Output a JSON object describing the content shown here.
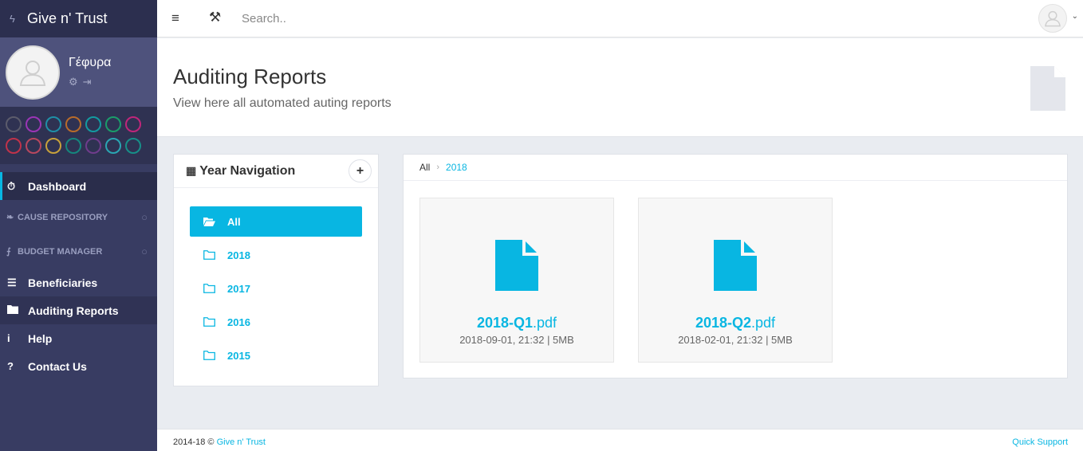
{
  "app": {
    "name": "Give n' Trust"
  },
  "user": {
    "name": "Γέφυρα"
  },
  "theme_colors": {
    "row1": [
      "#5b5b6b",
      "#9b35b5",
      "#1f8fa6",
      "#b86b2a",
      "#139aa0",
      "#1a9c6a",
      "#c0267a"
    ],
    "row2": [
      "#c0324a",
      "#b8475e",
      "#c7a13b",
      "#15867d",
      "#6f3c8c",
      "#2aa6b2",
      "#178f88"
    ]
  },
  "sidebar": {
    "dashboard": "Dashboard",
    "cause_repository": "CAUSE REPOSITORY",
    "budget_manager": "BUDGET MANAGER",
    "beneficiaries": "Beneficiaries",
    "auditing_reports": "Auditing Reports",
    "help": "Help",
    "contact_us": "Contact Us"
  },
  "topbar": {
    "search_placeholder": "Search.."
  },
  "page": {
    "title": "Auditing Reports",
    "subtitle": "View here all automated auting reports"
  },
  "year_nav": {
    "title": "Year Navigation",
    "add_label": "+",
    "items": [
      "All",
      "2018",
      "2017",
      "2016",
      "2015"
    ]
  },
  "breadcrumb": {
    "root": "All",
    "current": "2018"
  },
  "files": [
    {
      "name": "2018-Q1",
      "ext": ".pdf",
      "meta": "2018-09-01, 21:32 | 5MB"
    },
    {
      "name": "2018-Q2",
      "ext": ".pdf",
      "meta": "2018-02-01, 21:32 | 5MB"
    }
  ],
  "footer": {
    "years": "2014-18 ©",
    "company": "Give n' Trust",
    "quick_support": "Quick Support"
  },
  "colors": {
    "accent": "#08b6e2",
    "sidebar": "#383c62"
  }
}
